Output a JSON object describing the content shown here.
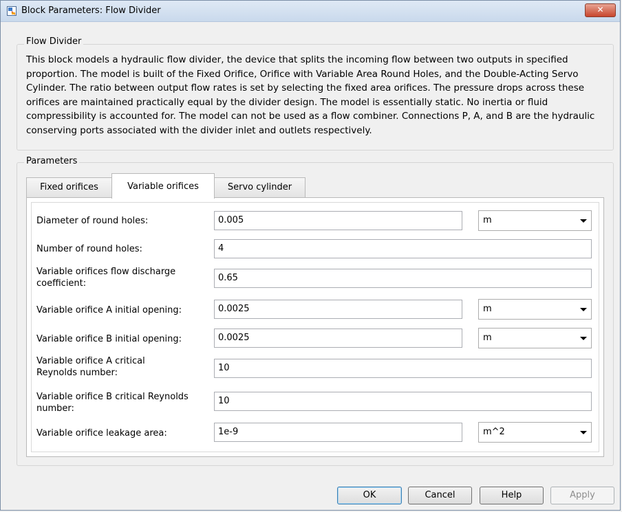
{
  "window": {
    "title": "Block Parameters: Flow Divider",
    "close_glyph": "✕",
    "app_icon": "simulink-block-icon"
  },
  "block_group": {
    "label": "Flow Divider",
    "description": "This block models a hydraulic flow divider, the device that splits the incoming flow between two outputs in specified proportion. The model is built of the Fixed Orifice, Orifice with Variable Area Round Holes, and the Double-Acting Servo Cylinder. The ratio between output flow rates is set by selecting the fixed area orifices. The pressure drops across these orifices are maintained practically equal by the divider design. The model is essentially static. No inertia or fluid compressibility is accounted for. The model can not be used as a flow combiner. Connections P, A, and B are the hydraulic conserving ports associated with the divider inlet and outlets respectively."
  },
  "parameters_group": {
    "label": "Parameters",
    "tabs": [
      {
        "label": "Fixed orifices",
        "active": false
      },
      {
        "label": "Variable orifices",
        "active": true
      },
      {
        "label": "Servo cylinder",
        "active": false
      }
    ],
    "rows": [
      {
        "label": "Diameter of round holes:",
        "value": "0.005",
        "unit": "m"
      },
      {
        "label": "Number of round holes:",
        "value": "4"
      },
      {
        "label": "Variable orifices flow discharge coefficient:",
        "value": "0.65"
      },
      {
        "label": "Variable orifice A initial opening:",
        "value": "0.0025",
        "unit": "m"
      },
      {
        "label": "Variable orifice B initial opening:",
        "value": "0.0025",
        "unit": "m"
      },
      {
        "label": "Variable orifice A critical Reynolds number:",
        "value": "10"
      },
      {
        "label": "Variable orifice B critical Reynolds number:",
        "value": "10"
      },
      {
        "label": "Variable orifice leakage area:",
        "value": "1e-9",
        "unit": "m^2"
      }
    ]
  },
  "buttons": {
    "ok": "OK",
    "cancel": "Cancel",
    "help": "Help",
    "apply": "Apply"
  },
  "colors": {
    "close_button": "#c7452d",
    "default_button_border": "#3c7fb1"
  }
}
